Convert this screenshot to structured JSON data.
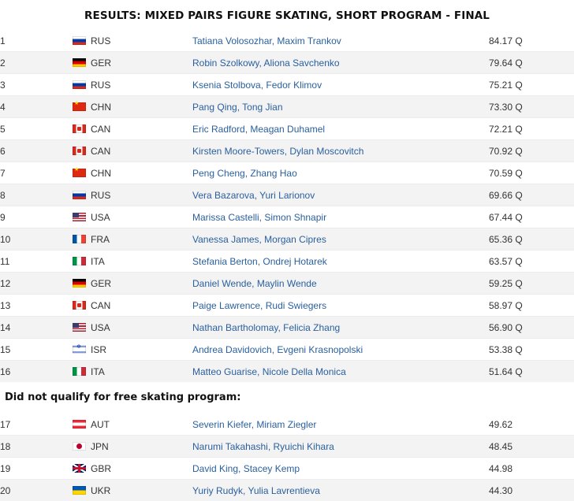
{
  "title": "RESULTS: MIXED PAIRS FIGURE SKATING, SHORT PROGRAM - FINAL",
  "qualified": [
    {
      "rank": "1",
      "country": "RUS",
      "flag_icon": "russia-flag-icon",
      "names": "Tatiana Volosozhar, Maxim Trankov",
      "score": "84.17 Q"
    },
    {
      "rank": "2",
      "country": "GER",
      "flag_icon": "germany-flag-icon",
      "names": "Robin Szolkowy, Aliona Savchenko",
      "score": "79.64 Q"
    },
    {
      "rank": "3",
      "country": "RUS",
      "flag_icon": "russia-flag-icon",
      "names": "Ksenia Stolbova, Fedor Klimov",
      "score": "75.21 Q"
    },
    {
      "rank": "4",
      "country": "CHN",
      "flag_icon": "china-flag-icon",
      "names": "Pang Qing, Tong Jian",
      "score": "73.30 Q"
    },
    {
      "rank": "5",
      "country": "CAN",
      "flag_icon": "canada-flag-icon",
      "names": "Eric Radford, Meagan Duhamel",
      "score": "72.21 Q"
    },
    {
      "rank": "6",
      "country": "CAN",
      "flag_icon": "canada-flag-icon",
      "names": "Kirsten Moore-Towers, Dylan Moscovitch",
      "score": "70.92 Q"
    },
    {
      "rank": "7",
      "country": "CHN",
      "flag_icon": "china-flag-icon",
      "names": "Peng Cheng, Zhang Hao",
      "score": "70.59 Q"
    },
    {
      "rank": "8",
      "country": "RUS",
      "flag_icon": "russia-flag-icon",
      "names": "Vera Bazarova, Yuri Larionov",
      "score": "69.66 Q"
    },
    {
      "rank": "9",
      "country": "USA",
      "flag_icon": "usa-flag-icon",
      "names": "Marissa Castelli, Simon Shnapir",
      "score": "67.44 Q"
    },
    {
      "rank": "10",
      "country": "FRA",
      "flag_icon": "france-flag-icon",
      "names": "Vanessa James, Morgan Cipres",
      "score": "65.36 Q"
    },
    {
      "rank": "11",
      "country": "ITA",
      "flag_icon": "italy-flag-icon",
      "names": "Stefania Berton, Ondrej Hotarek",
      "score": "63.57 Q"
    },
    {
      "rank": "12",
      "country": "GER",
      "flag_icon": "germany-flag-icon",
      "names": "Daniel Wende, Maylin Wende",
      "score": "59.25 Q"
    },
    {
      "rank": "13",
      "country": "CAN",
      "flag_icon": "canada-flag-icon",
      "names": "Paige Lawrence, Rudi Swiegers",
      "score": "58.97 Q"
    },
    {
      "rank": "14",
      "country": "USA",
      "flag_icon": "usa-flag-icon",
      "names": "Nathan Bartholomay, Felicia Zhang",
      "score": "56.90 Q"
    },
    {
      "rank": "15",
      "country": "ISR",
      "flag_icon": "israel-flag-icon",
      "names": "Andrea Davidovich, Evgeni Krasnopolski",
      "score": "53.38 Q"
    },
    {
      "rank": "16",
      "country": "ITA",
      "flag_icon": "italy-flag-icon",
      "names": "Matteo Guarise, Nicole Della Monica",
      "score": "51.64 Q"
    }
  ],
  "dnq_header": "Did not qualify for free skating program:",
  "not_qualified": [
    {
      "rank": "17",
      "country": "AUT",
      "flag_icon": "austria-flag-icon",
      "names": "Severin Kiefer, Miriam Ziegler",
      "score": "49.62"
    },
    {
      "rank": "18",
      "country": "JPN",
      "flag_icon": "japan-flag-icon",
      "names": "Narumi Takahashi, Ryuichi Kihara",
      "score": "48.45"
    },
    {
      "rank": "19",
      "country": "GBR",
      "flag_icon": "uk-flag-icon",
      "names": "David King, Stacey Kemp",
      "score": "44.98"
    },
    {
      "rank": "20",
      "country": "UKR",
      "flag_icon": "ukraine-flag-icon",
      "names": "Yuriy Rudyk, Yulia Lavrentieva",
      "score": "44.30"
    }
  ]
}
